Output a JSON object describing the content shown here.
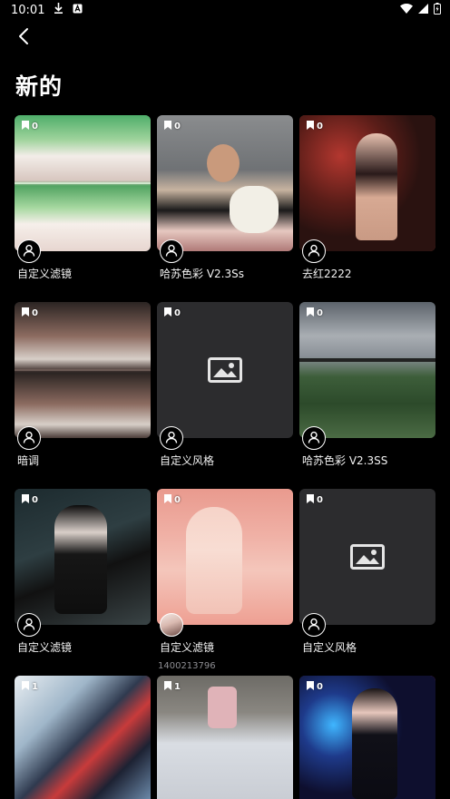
{
  "status_bar": {
    "time": "10:01"
  },
  "header": {
    "back_icon": "chevron-left-icon",
    "title": "新的"
  },
  "cards": [
    {
      "count": "0",
      "title": "自定义滤镜",
      "subtitle": ""
    },
    {
      "count": "0",
      "title": "哈苏色彩 V2.3Ss",
      "subtitle": ""
    },
    {
      "count": "0",
      "title": "去红2222",
      "subtitle": ""
    },
    {
      "count": "0",
      "title": "暗调",
      "subtitle": ""
    },
    {
      "count": "0",
      "title": "自定义风格",
      "subtitle": ""
    },
    {
      "count": "0",
      "title": "哈苏色彩 V2.3SS",
      "subtitle": ""
    },
    {
      "count": "0",
      "title": "自定义滤镜",
      "subtitle": ""
    },
    {
      "count": "0",
      "title": "自定义滤镜",
      "subtitle": "1400213796"
    },
    {
      "count": "0",
      "title": "自定义风格",
      "subtitle": ""
    },
    {
      "count": "1",
      "title": "",
      "subtitle": ""
    },
    {
      "count": "1",
      "title": "",
      "subtitle": ""
    },
    {
      "count": "0",
      "title": "",
      "subtitle": ""
    }
  ],
  "colors": {
    "background": "#000000",
    "card_placeholder": "#2c2c2e",
    "text_primary": "#f2f2f2",
    "text_secondary": "#8e8e93"
  }
}
